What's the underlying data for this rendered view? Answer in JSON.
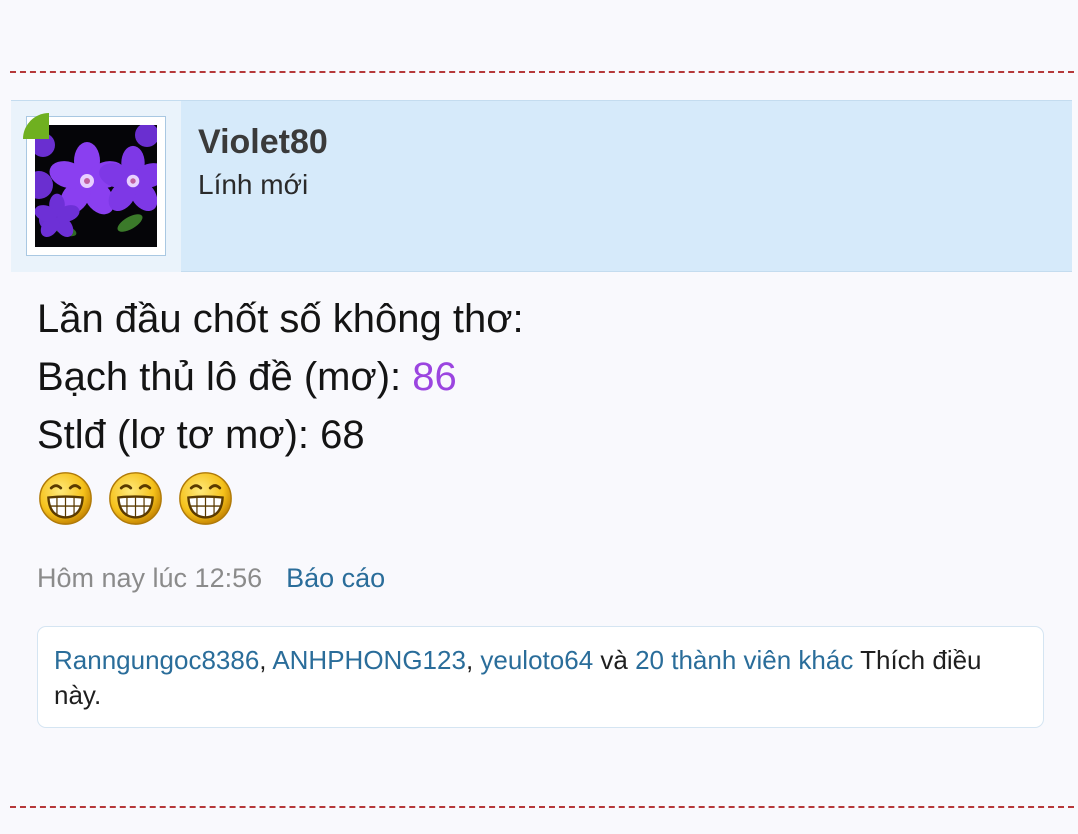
{
  "user": {
    "name": "Violet80",
    "title": "Lính mới",
    "avatar": "purple-flowers-avatar"
  },
  "message": {
    "line1": "Lần đầu chốt số không thơ:",
    "line2_prefix": "Bạch thủ lô đề (mơ): ",
    "line2_number": "86",
    "line3": "Stlđ (lơ tơ mơ): 68",
    "smilies": [
      "grin-smiley-icon",
      "grin-smiley-icon",
      "grin-smiley-icon"
    ]
  },
  "meta": {
    "date": "Hôm nay lúc 12:56",
    "report_label": "Báo cáo"
  },
  "likes": {
    "user1": "Ranngungoc8386",
    "user2": "ANHPHONG123",
    "user3": "yeuloto64",
    "sep": ", ",
    "and": " và ",
    "others": "20 thành viên khác",
    "suffix": " Thích điều này."
  },
  "colors": {
    "header_bg": "#d6eafa",
    "link": "#2a6d9a",
    "number_highlight": "#9b45e0",
    "separator": "#b5383a",
    "online": "#6fb020"
  }
}
